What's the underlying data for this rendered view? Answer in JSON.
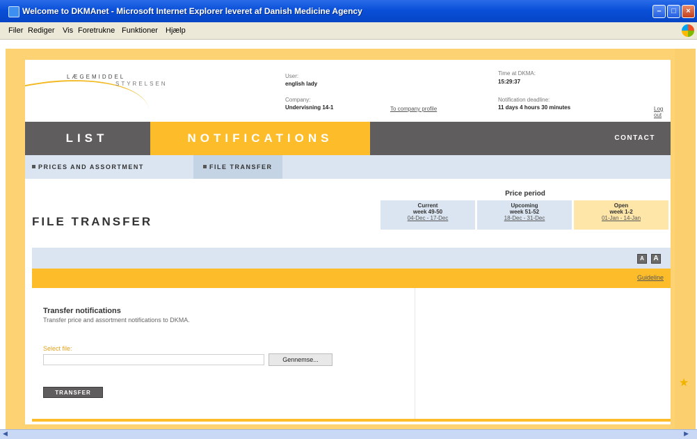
{
  "window": {
    "title": "Welcome to DKMAnet - Microsoft Internet Explorer leveret af Danish Medicine Agency",
    "controls": {
      "minimize": "–",
      "maximize": "□",
      "close": "×"
    }
  },
  "menu": {
    "items": [
      "Filer",
      "Rediger",
      "Vis",
      "Foretrukne",
      "Funktioner",
      "Hjælp"
    ]
  },
  "logo": {
    "line1": "LÆGEMIDDEL",
    "line2": "STYRELSEN"
  },
  "header": {
    "user_label": "User:",
    "user_value": "english lady",
    "company_label": "Company:",
    "company_value": "Undervisning 14-1",
    "company_profile_link": "To company profile",
    "time_label": "Time at DKMA:",
    "time_value": "15:29:37",
    "deadline_label": "Notification deadline:",
    "deadline_value": "11 days 4 hours 30 minutes",
    "logout_link": "Log out"
  },
  "nav": {
    "list": "LIST",
    "notifications": "NOTIFICATIONS",
    "contact": "CONTACT"
  },
  "subnav": {
    "prices": "PRICES AND ASSORTMENT",
    "file_transfer": "FILE TRANSFER"
  },
  "page_title": "FILE TRANSFER",
  "price_period": {
    "title": "Price period",
    "periods": [
      {
        "name": "Current",
        "week": "week 49-50",
        "dates": "04-Dec - 17-Dec",
        "color": "#dbe5f1"
      },
      {
        "name": "Upcoming",
        "week": "week 51-52",
        "dates": "18-Dec - 31-Dec",
        "color": "#dbe5f1"
      },
      {
        "name": "Open",
        "week": "week 1-2",
        "dates": "01-Jan - 14-Jan",
        "color": "#fde6a8"
      }
    ]
  },
  "panel": {
    "size_small": "A",
    "size_large": "A",
    "guideline_link": "Guideline",
    "transfer_title": "Transfer notifications",
    "transfer_desc": "Transfer price and assortment notifications to DKMA.",
    "select_label": "Select file:",
    "file_value": "",
    "browse_button": "Gennemse...",
    "transfer_button": "TRANSFER"
  },
  "colors": {
    "accent": "#fdbd2a",
    "nav_bg": "#5f5d5e",
    "subnav_bg": "#dbe5f1"
  }
}
